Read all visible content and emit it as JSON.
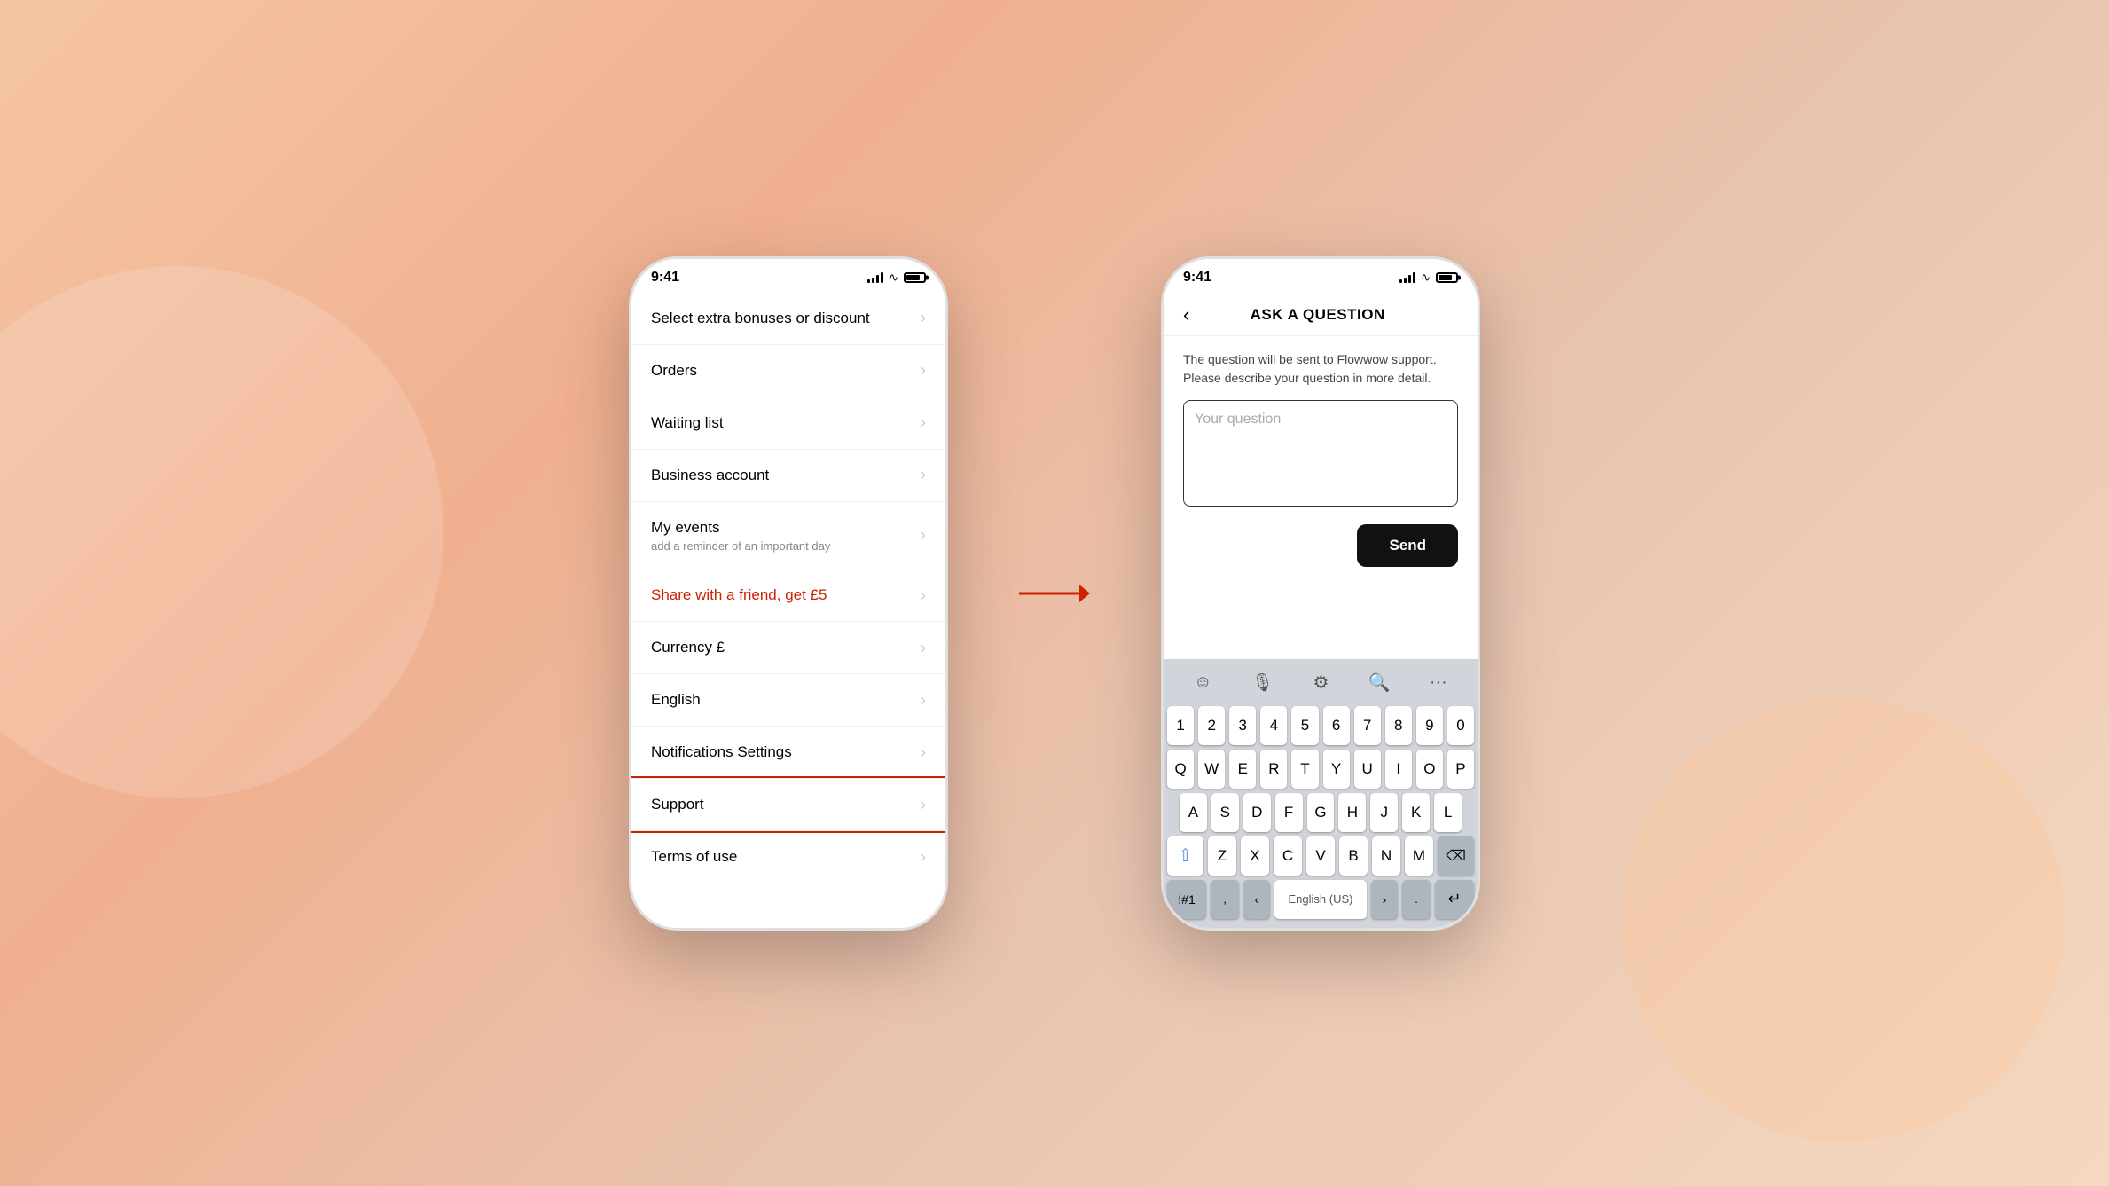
{
  "phone1": {
    "time": "9:41",
    "menu_items": [
      {
        "id": "bonuses",
        "title": "Select extra bonuses or discount",
        "subtitle": "",
        "highlight": false,
        "selected": false
      },
      {
        "id": "orders",
        "title": "Orders",
        "subtitle": "",
        "highlight": false,
        "selected": false
      },
      {
        "id": "waiting",
        "title": "Waiting list",
        "subtitle": "",
        "highlight": false,
        "selected": false
      },
      {
        "id": "business",
        "title": "Business account",
        "subtitle": "",
        "highlight": false,
        "selected": false
      },
      {
        "id": "myevents",
        "title": "My events",
        "subtitle": "add a reminder of an important day",
        "highlight": false,
        "selected": false
      },
      {
        "id": "share",
        "title": "Share with a friend, get £5",
        "subtitle": "",
        "highlight": true,
        "selected": false
      },
      {
        "id": "currency",
        "title": "Currency £",
        "subtitle": "",
        "highlight": false,
        "selected": false
      },
      {
        "id": "english",
        "title": "English",
        "subtitle": "",
        "highlight": false,
        "selected": false
      },
      {
        "id": "notifications",
        "title": "Notifications Settings",
        "subtitle": "",
        "highlight": false,
        "selected": false
      },
      {
        "id": "support",
        "title": "Support",
        "subtitle": "",
        "highlight": false,
        "selected": true
      },
      {
        "id": "terms",
        "title": "Terms of use",
        "subtitle": "",
        "highlight": false,
        "selected": false
      }
    ]
  },
  "phone2": {
    "time": "9:41",
    "header_title": "ASK A QUESTION",
    "description": "The question will be sent to Flowwow support. Please describe your question in more detail.",
    "textarea_placeholder": "Your question",
    "send_button_label": "Send",
    "keyboard": {
      "row1": [
        "1",
        "2",
        "3",
        "4",
        "5",
        "6",
        "7",
        "8",
        "9",
        "0"
      ],
      "row2": [
        "Q",
        "W",
        "E",
        "R",
        "T",
        "Y",
        "U",
        "I",
        "O",
        "P"
      ],
      "row3": [
        "A",
        "S",
        "D",
        "F",
        "G",
        "H",
        "J",
        "K",
        "L"
      ],
      "row4": [
        "Z",
        "X",
        "C",
        "V",
        "B",
        "N",
        "M"
      ],
      "special_left": "!#1",
      "comma": ",",
      "space_label": "English (US)",
      "period": ".",
      "toolbar_items": [
        "emoji",
        "mic",
        "settings",
        "search",
        "more"
      ]
    }
  },
  "arrow": "→",
  "colors": {
    "highlight_red": "#cc2200",
    "send_bg": "#111111",
    "keyboard_bg": "#d1d5db",
    "key_bg": "#ffffff",
    "special_key_bg": "#adb5bd"
  }
}
